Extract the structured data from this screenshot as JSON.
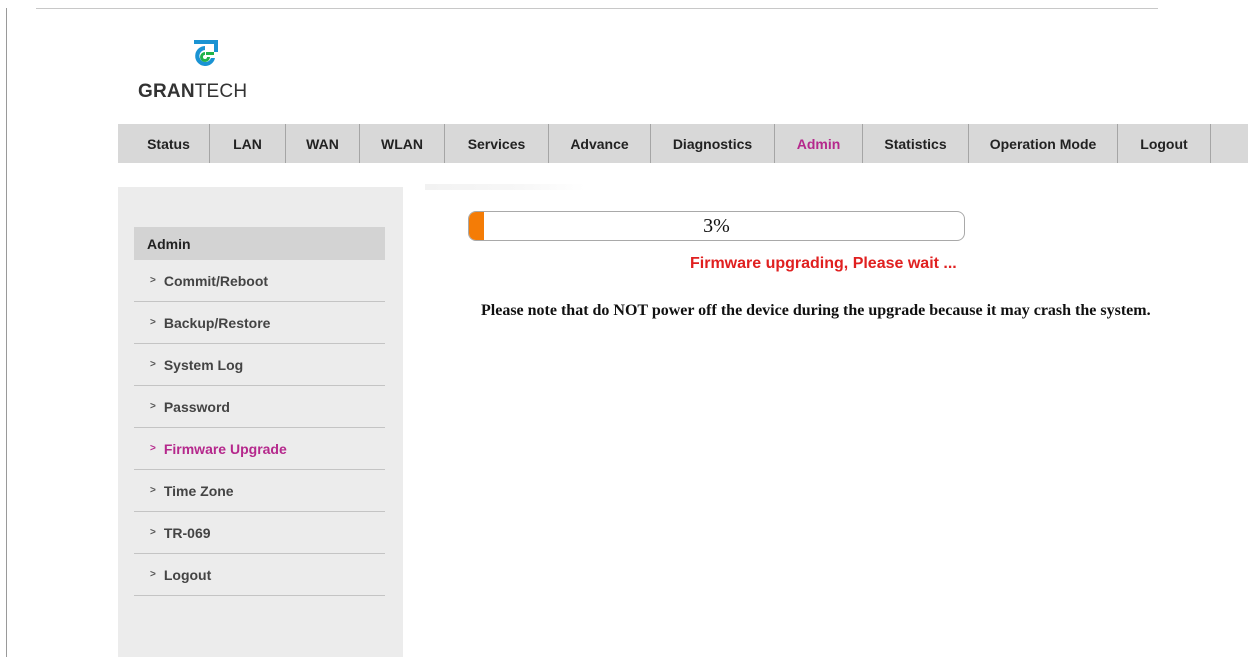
{
  "brand": {
    "name_bold": "GRAN",
    "name_rest": "TECH",
    "colors": {
      "logo_blue": "#1a93d3",
      "logo_green": "#20b24a"
    }
  },
  "nav": {
    "items": [
      {
        "label": "Status",
        "active": false
      },
      {
        "label": "LAN",
        "active": false
      },
      {
        "label": "WAN",
        "active": false
      },
      {
        "label": "WLAN",
        "active": false
      },
      {
        "label": "Services",
        "active": false
      },
      {
        "label": "Advance",
        "active": false
      },
      {
        "label": "Diagnostics",
        "active": false
      },
      {
        "label": "Admin",
        "active": true
      },
      {
        "label": "Statistics",
        "active": false
      },
      {
        "label": "Operation Mode",
        "active": false
      },
      {
        "label": "Logout",
        "active": false
      }
    ],
    "active_color": "#b5288c"
  },
  "sidebar": {
    "header": "Admin",
    "items": [
      {
        "label": "Commit/Reboot",
        "active": false
      },
      {
        "label": "Backup/Restore",
        "active": false
      },
      {
        "label": "System Log",
        "active": false
      },
      {
        "label": "Password",
        "active": false
      },
      {
        "label": "Firmware Upgrade",
        "active": true
      },
      {
        "label": "Time Zone",
        "active": false
      },
      {
        "label": "TR-069",
        "active": false
      },
      {
        "label": "Logout",
        "active": false
      }
    ]
  },
  "upgrade": {
    "progress_percent": 3,
    "progress_label": "3%",
    "status_message": "Firmware upgrading, Please wait ...",
    "status_color": "#e02020",
    "progress_color": "#f47c06",
    "note": "Please note that do NOT power off the device during the upgrade because it may crash the system."
  }
}
